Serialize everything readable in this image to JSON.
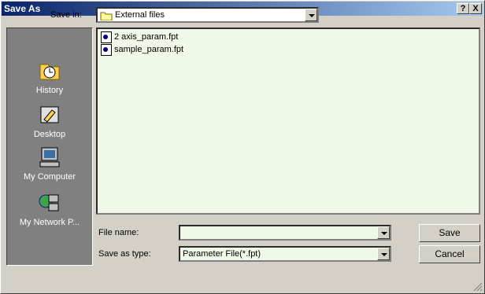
{
  "window": {
    "title": "Save As",
    "help_button": "?",
    "close_button": "X"
  },
  "save_in": {
    "label": "Save in:",
    "value": "External files"
  },
  "places": [
    {
      "label": "History",
      "icon": "history-icon"
    },
    {
      "label": "Desktop",
      "icon": "desktop-icon"
    },
    {
      "label": "My Computer",
      "icon": "my-computer-icon"
    },
    {
      "label": "My Network P...",
      "icon": "network-places-icon"
    }
  ],
  "files": [
    {
      "name": "2 axis_param.fpt"
    },
    {
      "name": "sample_param.fpt"
    }
  ],
  "file_name": {
    "label": "File name:",
    "value": ""
  },
  "save_as_type": {
    "label": "Save as type:",
    "value": "Parameter File(*.fpt)"
  },
  "buttons": {
    "save": "Save",
    "cancel": "Cancel"
  },
  "colors": {
    "titlebar_start": "#0a246a",
    "titlebar_end": "#a6caf0",
    "list_bg": "#f0f8e8"
  }
}
